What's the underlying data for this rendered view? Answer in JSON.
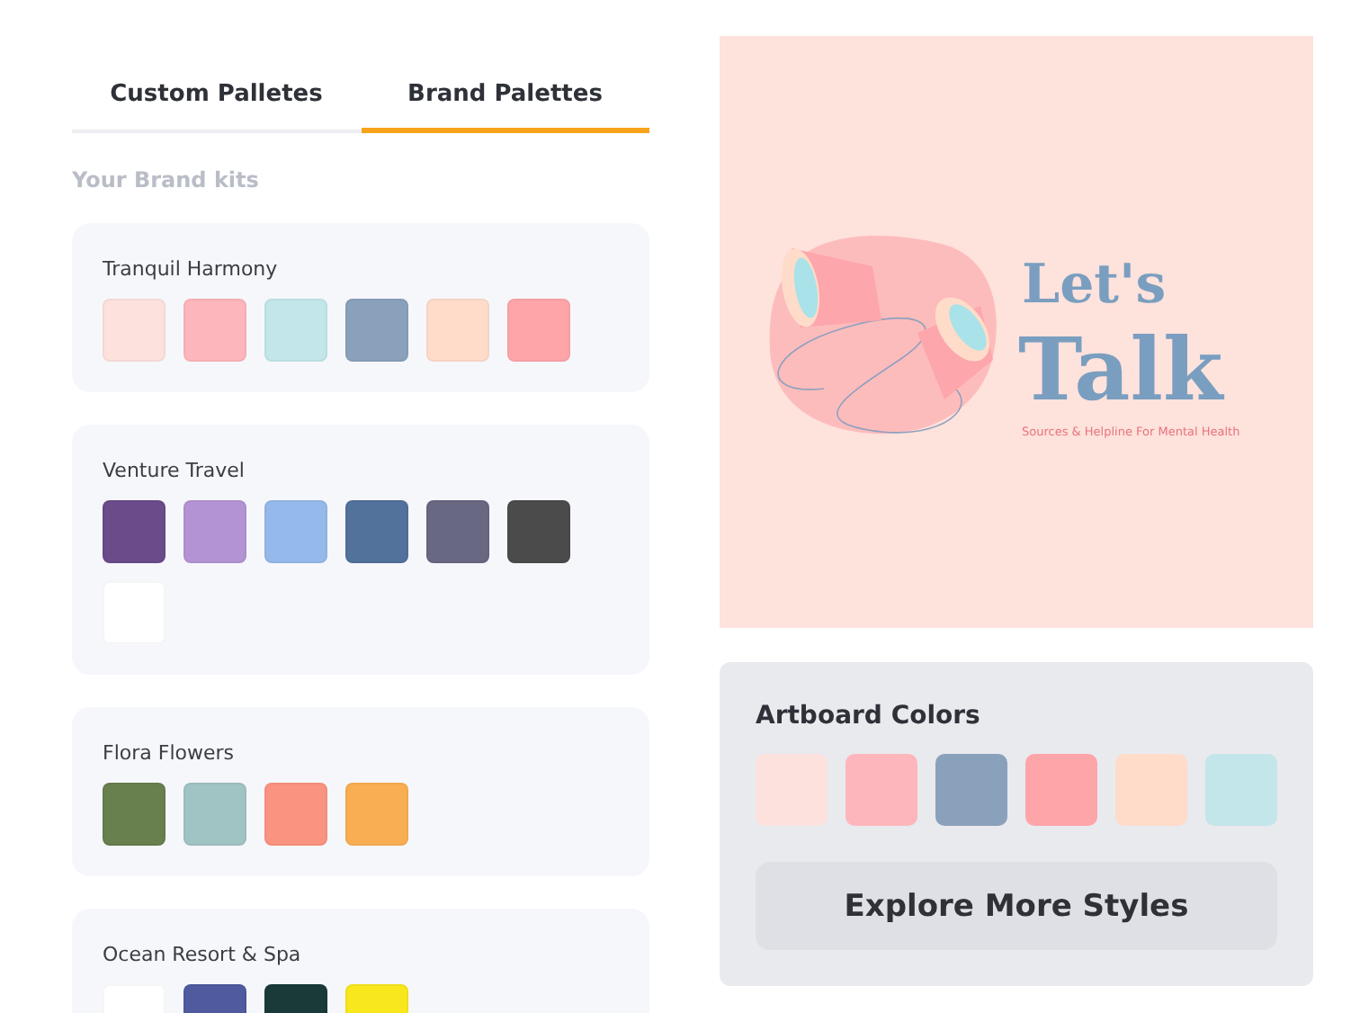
{
  "tabs": [
    {
      "label": "Custom Palletes",
      "selected": false
    },
    {
      "label": "Brand Palettes",
      "selected": true
    }
  ],
  "section_title": "Your Brand kits",
  "palettes": [
    {
      "name": "Tranquil Harmony",
      "colors": [
        {
          "color": "#fde1dc"
        },
        {
          "color": "#fdb6bb"
        },
        {
          "color": "#c2e6e9"
        },
        {
          "color": "#8aa1bc"
        },
        {
          "color": "#fedcc9"
        },
        {
          "color": "#fea5aa"
        }
      ]
    },
    {
      "name": "Venture Travel",
      "colors": [
        {
          "color": "#6b4b8a"
        },
        {
          "color": "#b393d3"
        },
        {
          "color": "#94b9ea"
        },
        {
          "color": "#52719b"
        },
        {
          "color": "#696883"
        },
        {
          "color": "#4b4b4b"
        },
        {
          "color": "#ffffff"
        }
      ]
    },
    {
      "name": "Flora Flowers",
      "colors": [
        {
          "color": "#687f4e"
        },
        {
          "color": "#a0c3c3"
        },
        {
          "color": "#fb9381"
        },
        {
          "color": "#f9ae52"
        }
      ]
    },
    {
      "name": "Ocean Resort & Spa",
      "colors": [
        {
          "color": "#ffffff"
        },
        {
          "color": "#4f5b9e"
        },
        {
          "color": "#1a3a3a"
        },
        {
          "color": "#f8e71c"
        }
      ]
    }
  ],
  "artboard": {
    "title_line_1": "Let's",
    "title_line_2": "Talk",
    "tagline": "Sources & Helpline For Mental Health"
  },
  "artboard_colors": {
    "title": "Artboard Colors",
    "colors": [
      {
        "color": "#fde1dc"
      },
      {
        "color": "#fdb6bb"
      },
      {
        "color": "#8aa1bc"
      },
      {
        "color": "#fea5aa"
      },
      {
        "color": "#fedcc9"
      },
      {
        "color": "#c2e6e9"
      }
    ],
    "button": "Explore More Styles"
  }
}
